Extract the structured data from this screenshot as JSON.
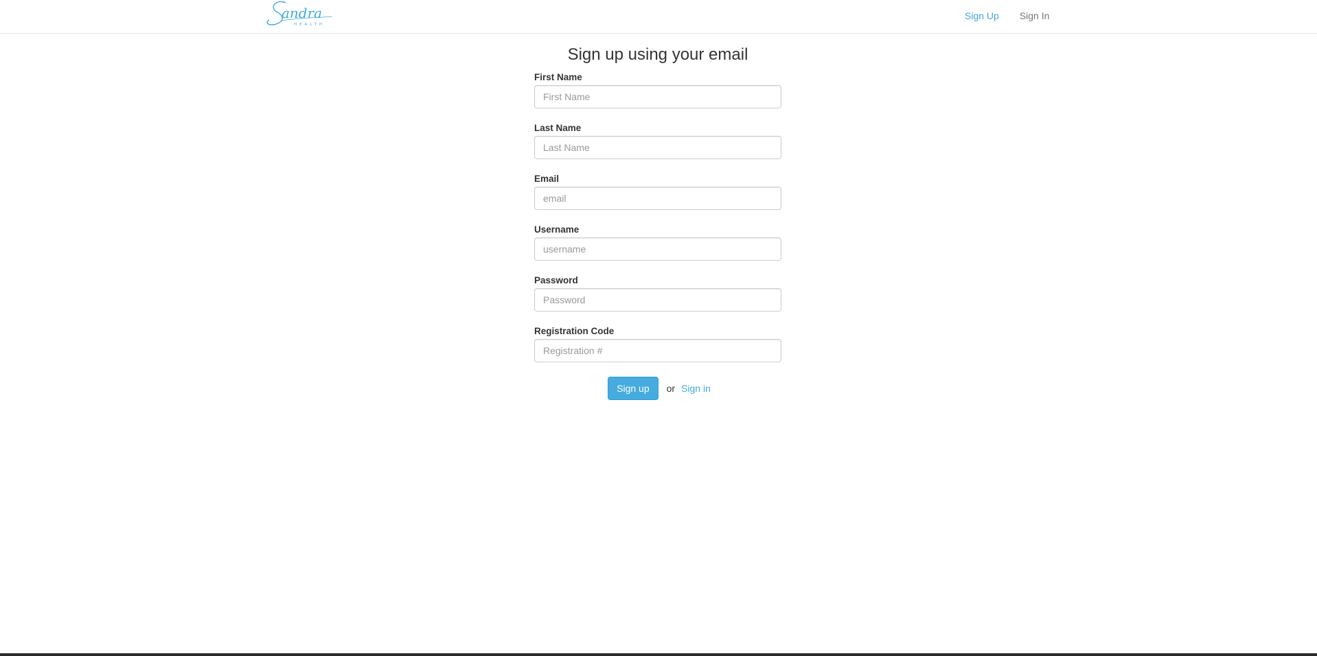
{
  "brand": {
    "logo_text": "Sandra",
    "logo_subtext": "HEALTH",
    "logo_color": "#3fa9dc"
  },
  "nav": {
    "signup_label": "Sign Up",
    "signin_label": "Sign In"
  },
  "form": {
    "title": "Sign up using your email",
    "fields": [
      {
        "label": "First Name",
        "placeholder": "First Name",
        "value": ""
      },
      {
        "label": "Last Name",
        "placeholder": "Last Name",
        "value": ""
      },
      {
        "label": "Email",
        "placeholder": "email",
        "value": ""
      },
      {
        "label": "Username",
        "placeholder": "username",
        "value": ""
      },
      {
        "label": "Password",
        "placeholder": "Password",
        "value": ""
      },
      {
        "label": "Registration Code",
        "placeholder": "Registration #",
        "value": ""
      }
    ],
    "submit_label": "Sign up",
    "or_text": "or",
    "signin_link": "Sign in"
  },
  "colors": {
    "accent": "#46acdf",
    "link": "#3fa9dc",
    "muted_link": "#777777",
    "border": "#cccccc"
  }
}
